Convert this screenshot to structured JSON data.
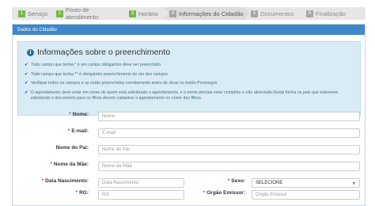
{
  "steps": [
    {
      "num": "1",
      "label": "Serviço",
      "state": "done"
    },
    {
      "num": "2",
      "label": "Posto de atendimento",
      "state": "done"
    },
    {
      "num": "3",
      "label": "Horário",
      "state": "done"
    },
    {
      "num": "4",
      "label": "Informações do Cidadão",
      "state": "active"
    },
    {
      "num": "5",
      "label": "Documentos",
      "state": "todo"
    },
    {
      "num": "6",
      "label": "Finalização",
      "state": "todo"
    }
  ],
  "panel": {
    "title": "Dados do Cidadão"
  },
  "info": {
    "title": "Informações sobre o preenchimento",
    "items": [
      "Todo campo que tenha * é um campo obrigatório deve ser preenchido",
      "Todo campo que tenha ** é obrigatório preenchimento de um dos campos",
      "Verifique todos os campos e se estão preenchidos corretamente antes de clicar no botão Prosseguir",
      "O agendamento deve estar em nome de quem está solicitando o agendamento, e o nome precisa estar completo e não abreviado.Desta forma os pais que estiverem solicitando o documento para os filhos devem cadastrar o agendamento no nome dos filhos."
    ]
  },
  "form": {
    "nome": {
      "label": "Nome:",
      "req": "*",
      "placeholder": "Nome"
    },
    "email": {
      "label": "E-mail:",
      "req": "*",
      "placeholder": "E-mail"
    },
    "pai": {
      "label": "Nome do Pai:",
      "req": "",
      "placeholder": "Nome do Pai"
    },
    "mae": {
      "label": "Nome da Mãe:",
      "req": "*",
      "placeholder": "Nome da Mãe"
    },
    "nascimento": {
      "label": "Data Nascimento:",
      "req": "*",
      "placeholder": "Data Nascimento"
    },
    "sexo": {
      "label": "Sexo:",
      "req": "*",
      "value": "SELECIONE"
    },
    "rg": {
      "label": "RG:",
      "req": "*",
      "placeholder": "RG"
    },
    "orgao": {
      "label": "Orgão Emissor:",
      "req": "*",
      "placeholder": "Orgão Emissor"
    }
  }
}
